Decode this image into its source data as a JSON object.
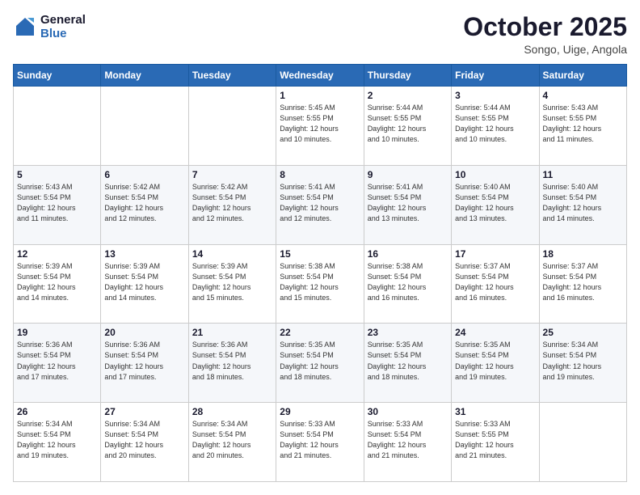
{
  "header": {
    "logo_line1": "General",
    "logo_line2": "Blue",
    "month": "October 2025",
    "location": "Songo, Uige, Angola"
  },
  "weekdays": [
    "Sunday",
    "Monday",
    "Tuesday",
    "Wednesday",
    "Thursday",
    "Friday",
    "Saturday"
  ],
  "weeks": [
    [
      {
        "day": "",
        "info": ""
      },
      {
        "day": "",
        "info": ""
      },
      {
        "day": "",
        "info": ""
      },
      {
        "day": "1",
        "info": "Sunrise: 5:45 AM\nSunset: 5:55 PM\nDaylight: 12 hours\nand 10 minutes."
      },
      {
        "day": "2",
        "info": "Sunrise: 5:44 AM\nSunset: 5:55 PM\nDaylight: 12 hours\nand 10 minutes."
      },
      {
        "day": "3",
        "info": "Sunrise: 5:44 AM\nSunset: 5:55 PM\nDaylight: 12 hours\nand 10 minutes."
      },
      {
        "day": "4",
        "info": "Sunrise: 5:43 AM\nSunset: 5:55 PM\nDaylight: 12 hours\nand 11 minutes."
      }
    ],
    [
      {
        "day": "5",
        "info": "Sunrise: 5:43 AM\nSunset: 5:54 PM\nDaylight: 12 hours\nand 11 minutes."
      },
      {
        "day": "6",
        "info": "Sunrise: 5:42 AM\nSunset: 5:54 PM\nDaylight: 12 hours\nand 12 minutes."
      },
      {
        "day": "7",
        "info": "Sunrise: 5:42 AM\nSunset: 5:54 PM\nDaylight: 12 hours\nand 12 minutes."
      },
      {
        "day": "8",
        "info": "Sunrise: 5:41 AM\nSunset: 5:54 PM\nDaylight: 12 hours\nand 12 minutes."
      },
      {
        "day": "9",
        "info": "Sunrise: 5:41 AM\nSunset: 5:54 PM\nDaylight: 12 hours\nand 13 minutes."
      },
      {
        "day": "10",
        "info": "Sunrise: 5:40 AM\nSunset: 5:54 PM\nDaylight: 12 hours\nand 13 minutes."
      },
      {
        "day": "11",
        "info": "Sunrise: 5:40 AM\nSunset: 5:54 PM\nDaylight: 12 hours\nand 14 minutes."
      }
    ],
    [
      {
        "day": "12",
        "info": "Sunrise: 5:39 AM\nSunset: 5:54 PM\nDaylight: 12 hours\nand 14 minutes."
      },
      {
        "day": "13",
        "info": "Sunrise: 5:39 AM\nSunset: 5:54 PM\nDaylight: 12 hours\nand 14 minutes."
      },
      {
        "day": "14",
        "info": "Sunrise: 5:39 AM\nSunset: 5:54 PM\nDaylight: 12 hours\nand 15 minutes."
      },
      {
        "day": "15",
        "info": "Sunrise: 5:38 AM\nSunset: 5:54 PM\nDaylight: 12 hours\nand 15 minutes."
      },
      {
        "day": "16",
        "info": "Sunrise: 5:38 AM\nSunset: 5:54 PM\nDaylight: 12 hours\nand 16 minutes."
      },
      {
        "day": "17",
        "info": "Sunrise: 5:37 AM\nSunset: 5:54 PM\nDaylight: 12 hours\nand 16 minutes."
      },
      {
        "day": "18",
        "info": "Sunrise: 5:37 AM\nSunset: 5:54 PM\nDaylight: 12 hours\nand 16 minutes."
      }
    ],
    [
      {
        "day": "19",
        "info": "Sunrise: 5:36 AM\nSunset: 5:54 PM\nDaylight: 12 hours\nand 17 minutes."
      },
      {
        "day": "20",
        "info": "Sunrise: 5:36 AM\nSunset: 5:54 PM\nDaylight: 12 hours\nand 17 minutes."
      },
      {
        "day": "21",
        "info": "Sunrise: 5:36 AM\nSunset: 5:54 PM\nDaylight: 12 hours\nand 18 minutes."
      },
      {
        "day": "22",
        "info": "Sunrise: 5:35 AM\nSunset: 5:54 PM\nDaylight: 12 hours\nand 18 minutes."
      },
      {
        "day": "23",
        "info": "Sunrise: 5:35 AM\nSunset: 5:54 PM\nDaylight: 12 hours\nand 18 minutes."
      },
      {
        "day": "24",
        "info": "Sunrise: 5:35 AM\nSunset: 5:54 PM\nDaylight: 12 hours\nand 19 minutes."
      },
      {
        "day": "25",
        "info": "Sunrise: 5:34 AM\nSunset: 5:54 PM\nDaylight: 12 hours\nand 19 minutes."
      }
    ],
    [
      {
        "day": "26",
        "info": "Sunrise: 5:34 AM\nSunset: 5:54 PM\nDaylight: 12 hours\nand 19 minutes."
      },
      {
        "day": "27",
        "info": "Sunrise: 5:34 AM\nSunset: 5:54 PM\nDaylight: 12 hours\nand 20 minutes."
      },
      {
        "day": "28",
        "info": "Sunrise: 5:34 AM\nSunset: 5:54 PM\nDaylight: 12 hours\nand 20 minutes."
      },
      {
        "day": "29",
        "info": "Sunrise: 5:33 AM\nSunset: 5:54 PM\nDaylight: 12 hours\nand 21 minutes."
      },
      {
        "day": "30",
        "info": "Sunrise: 5:33 AM\nSunset: 5:54 PM\nDaylight: 12 hours\nand 21 minutes."
      },
      {
        "day": "31",
        "info": "Sunrise: 5:33 AM\nSunset: 5:55 PM\nDaylight: 12 hours\nand 21 minutes."
      },
      {
        "day": "",
        "info": ""
      }
    ]
  ]
}
